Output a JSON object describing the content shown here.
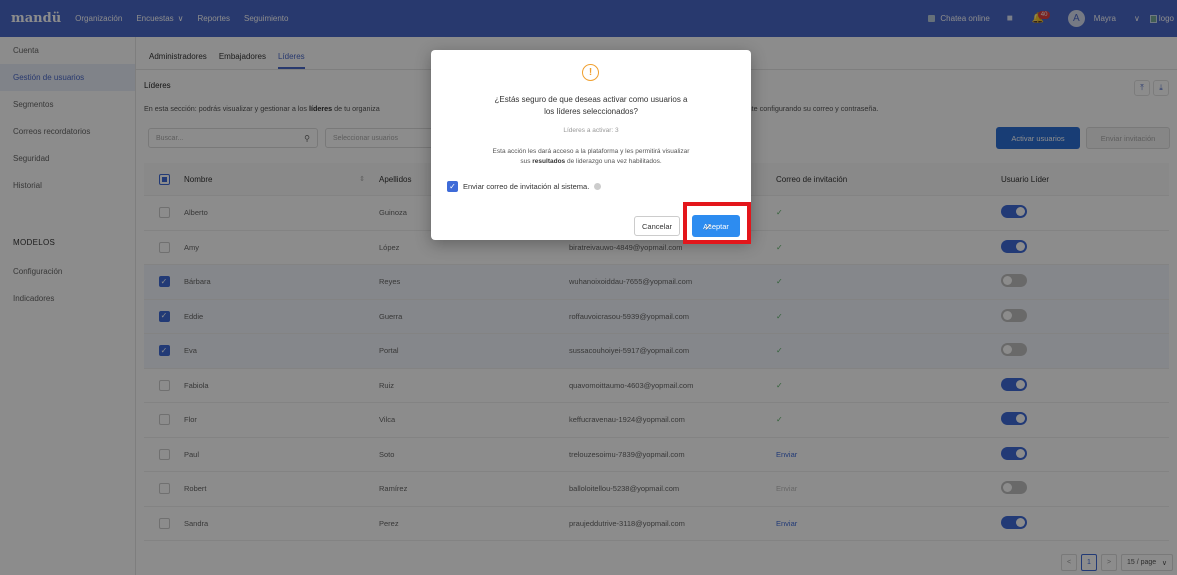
{
  "topbar": {
    "logo": "mandü",
    "nav": [
      {
        "label": "Organización",
        "chevron": false
      },
      {
        "label": "Encuestas",
        "chevron": true
      },
      {
        "label": "Reportes",
        "chevron": false
      },
      {
        "label": "Seguimiento",
        "chevron": false
      }
    ],
    "chat_label": "Chatea online",
    "notification_count": "40",
    "avatar_letter": "A",
    "user_name": "Mayra",
    "logo_alt": "logo",
    "accent_color": "#4a68c9"
  },
  "sidebar": {
    "items": [
      "Cuenta",
      "Gestión de usuarios",
      "Segmentos",
      "Correos recordatorios",
      "Seguridad",
      "Historial"
    ],
    "active_index": 1,
    "section_title": "MODELOS",
    "section_items": [
      "Configuración",
      "Indicadores"
    ]
  },
  "tabs": [
    "Administradores",
    "Embajadores",
    "Líderes"
  ],
  "active_tab": 2,
  "section": {
    "title": "Líderes",
    "desc_prefix": "En esta sección: podrás visualizar y gestionar a los ",
    "desc_bold": "líderes",
    "desc_mid": " de tu organiza",
    "desc_suffix": "rma, previamente configurando su correo y contraseña."
  },
  "toolbar": {
    "search_placeholder": "Buscar...",
    "select_placeholder": "Seleccionar usuarios",
    "activate_label": "Activar usuarios",
    "invite_label": "Enviar invitación"
  },
  "table": {
    "headers": {
      "name": "Nombre",
      "last": "Apellidos",
      "invite": "Correo de invitación",
      "leader": "Usuario Líder"
    },
    "rows": [
      {
        "checked": false,
        "name": "Alberto",
        "last": "Guinoza",
        "email": "",
        "invite": "✓",
        "invite_type": "ok",
        "leader": true
      },
      {
        "checked": false,
        "name": "Amy",
        "last": "López",
        "email": "biratreivauwo-4849@yopmail.com",
        "invite": "✓",
        "invite_type": "ok",
        "leader": true
      },
      {
        "checked": true,
        "name": "Bárbara",
        "last": "Reyes",
        "email": "wuhanoixoiddau-7655@yopmail.com",
        "invite": "✓",
        "invite_type": "ok",
        "leader": false
      },
      {
        "checked": true,
        "name": "Eddie",
        "last": "Guerra",
        "email": "roffauvoicrasou-5939@yopmail.com",
        "invite": "✓",
        "invite_type": "ok",
        "leader": false
      },
      {
        "checked": true,
        "name": "Eva",
        "last": "Portal",
        "email": "sussacouhoiyei-5917@yopmail.com",
        "invite": "✓",
        "invite_type": "ok",
        "leader": false
      },
      {
        "checked": false,
        "name": "Fabiola",
        "last": "Ruiz",
        "email": "quavomoittaumo-4603@yopmail.com",
        "invite": "✓",
        "invite_type": "ok",
        "leader": true
      },
      {
        "checked": false,
        "name": "Flor",
        "last": "Vilca",
        "email": "keffucravenau-1924@yopmail.com",
        "invite": "✓",
        "invite_type": "ok",
        "leader": true
      },
      {
        "checked": false,
        "name": "Paul",
        "last": "Soto",
        "email": "trelouzesoimu-7839@yopmail.com",
        "invite": "Enviar",
        "invite_type": "link",
        "leader": true
      },
      {
        "checked": false,
        "name": "Robert",
        "last": "Ramírez",
        "email": "balloloitellou-5238@yopmail.com",
        "invite": "Enviar",
        "invite_type": "disabled",
        "leader": false
      },
      {
        "checked": false,
        "name": "Sandra",
        "last": "Perez",
        "email": "praujeddutrive-3118@yopmail.com",
        "invite": "Enviar",
        "invite_type": "link",
        "leader": true
      }
    ]
  },
  "pagination": {
    "prev": "<",
    "page": "1",
    "next": ">",
    "page_size": "15 / page"
  },
  "modal": {
    "icon": "!",
    "question_line1": "¿Estás seguro de que deseas activar como usuarios a",
    "question_line2": "los líderes seleccionados?",
    "sub": "Líderes a activar: 3",
    "desc_line1": "Esta acción les dará acceso a la plataforma y les permitirá visualizar",
    "desc_pre": "sus ",
    "desc_bold": "resultados",
    "desc_post": " de liderazgo una vez habilitados.",
    "checkbox_label": "Enviar correo de invitación al sistema.",
    "checkbox_checked": true,
    "cancel_label": "Cancelar",
    "accept_label": "Aceptar",
    "highlight_color": "#e3161b"
  }
}
